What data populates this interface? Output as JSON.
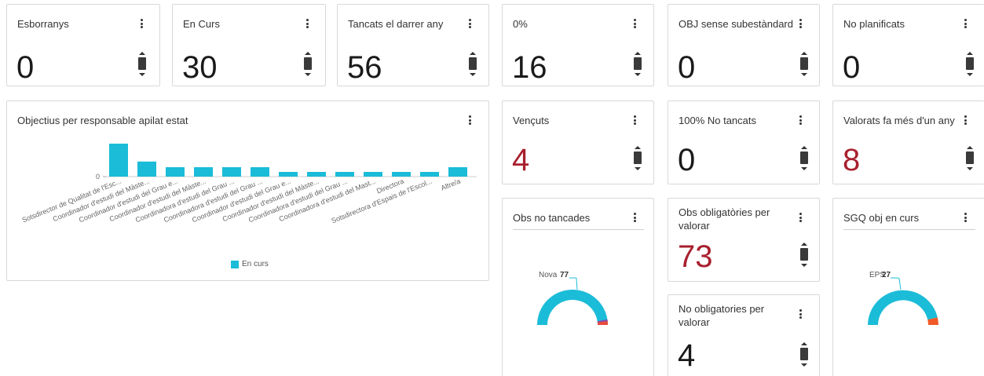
{
  "kpis": [
    {
      "title": "Esborranys",
      "value": "0",
      "color": "normal"
    },
    {
      "title": "En Curs",
      "value": "30",
      "color": "normal"
    },
    {
      "title": "Tancats el darrer any",
      "value": "56",
      "color": "normal"
    },
    {
      "title": "0%",
      "value": "16",
      "color": "normal"
    },
    {
      "title": "OBJ sense subestàndard",
      "value": "0",
      "color": "normal"
    },
    {
      "title": "No planificats",
      "value": "0",
      "color": "normal"
    },
    {
      "title": "Vençuts",
      "value": "4",
      "color": "alert"
    },
    {
      "title": "100% No tancats",
      "value": "0",
      "color": "normal"
    },
    {
      "title": "Valorats fa més d'un any",
      "value": "8",
      "color": "alert"
    },
    {
      "title": "Obs obligatòries per valorar",
      "value": "73",
      "color": "alert"
    },
    {
      "title": "No obligatories per valorar",
      "value": "4",
      "color": "normal"
    }
  ],
  "bar_chart": {
    "title": "Objectius per responsable apilat estat",
    "legend": "En curs"
  },
  "chart_data": [
    {
      "type": "bar",
      "title": "Objectius per responsable apilat estat",
      "categories": [
        "Sotsdirector de Qualitat de l'Esc...",
        "Coordinador d'estudi del Màste...",
        "Coordinador d'estudi del Grau e...",
        "Coordinador d'estudi del Màste...",
        "Coordinadora d'estudi del Grau ...",
        "Coordinadora d'estudi del Grau ...",
        "Coordinador d'estudi del Grau e...",
        "Coordinador d'estudi del Màste...",
        "Coordinadora d'estudi del Grau ...",
        "Coordinadora d'estudi del Mast...",
        "Directora",
        "Sotsdirectora d'Espais de l'Escol...",
        "Altre/a"
      ],
      "series": [
        {
          "name": "En curs",
          "values": [
            7,
            3.2,
            2,
            2,
            2,
            2,
            1,
            1,
            1,
            1,
            1,
            1,
            2
          ]
        }
      ],
      "ytick": "0",
      "legend": "bottom",
      "color": "#1bbcd8"
    },
    {
      "type": "pie",
      "title": "Obs no tancades",
      "label": "Nova",
      "value": "77",
      "slices": [
        {
          "name": "Nova",
          "value": 77,
          "color": "#1bbcd8"
        },
        {
          "name": "other-1",
          "value": 1,
          "color": "#e74c3c"
        },
        {
          "name": "other-2",
          "value": 1,
          "color": "#8e44ad"
        }
      ]
    },
    {
      "type": "pie",
      "title": "SGQ obj en curs",
      "label": "EPS",
      "value": "27",
      "slices": [
        {
          "name": "EPS",
          "value": 27,
          "color": "#1bbcd8"
        },
        {
          "name": "other",
          "value": 3,
          "color": "#f05a28"
        }
      ]
    }
  ],
  "donut_obs": {
    "title": "Obs no tancades",
    "label": "Nova",
    "value": "77"
  },
  "donut_sgq": {
    "title": "SGQ obj en curs",
    "label": "EPS",
    "value": "27"
  }
}
